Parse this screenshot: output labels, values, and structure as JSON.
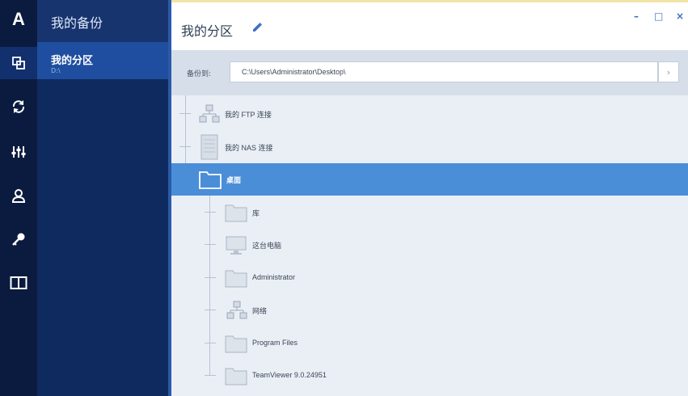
{
  "rail": {
    "logo": "A",
    "items": [
      {
        "icon": "backups-icon"
      },
      {
        "icon": "sync-icon"
      },
      {
        "icon": "tools-icon"
      },
      {
        "icon": "account-icon"
      },
      {
        "icon": "key-icon"
      },
      {
        "icon": "book-icon"
      }
    ]
  },
  "backups": {
    "title": "我的备份",
    "items": [
      {
        "name": "我的分区",
        "sub": "D:\\"
      }
    ]
  },
  "main": {
    "title": "我的分区",
    "window_controls": {
      "minimize": "–",
      "maximize": "□",
      "close": "×"
    },
    "path": {
      "label": "备份到:",
      "value": "C:\\Users\\Administrator\\Desktop\\",
      "button": "›"
    },
    "tree": [
      {
        "label": "我的 FTP 连接",
        "icon": "network-icon"
      },
      {
        "label": "我的 NAS 连接",
        "icon": "nas-icon"
      },
      {
        "label": "桌面",
        "icon": "folder-icon",
        "selected": true
      },
      {
        "label": "库",
        "icon": "folder-icon"
      },
      {
        "label": "这台电脑",
        "icon": "computer-icon"
      },
      {
        "label": "Administrator",
        "icon": "folder-icon"
      },
      {
        "label": "网络",
        "icon": "network-icon"
      },
      {
        "label": "Program Files",
        "icon": "folder-icon"
      },
      {
        "label": "TeamViewer 9.0.24951",
        "icon": "folder-icon"
      }
    ]
  },
  "colors": {
    "rail": "#0b1b3f",
    "panel": "#0f2a5e",
    "selected_item": "#1f4ea0",
    "accent": "#4a8ed8",
    "tree_bg": "#eaeff6"
  }
}
